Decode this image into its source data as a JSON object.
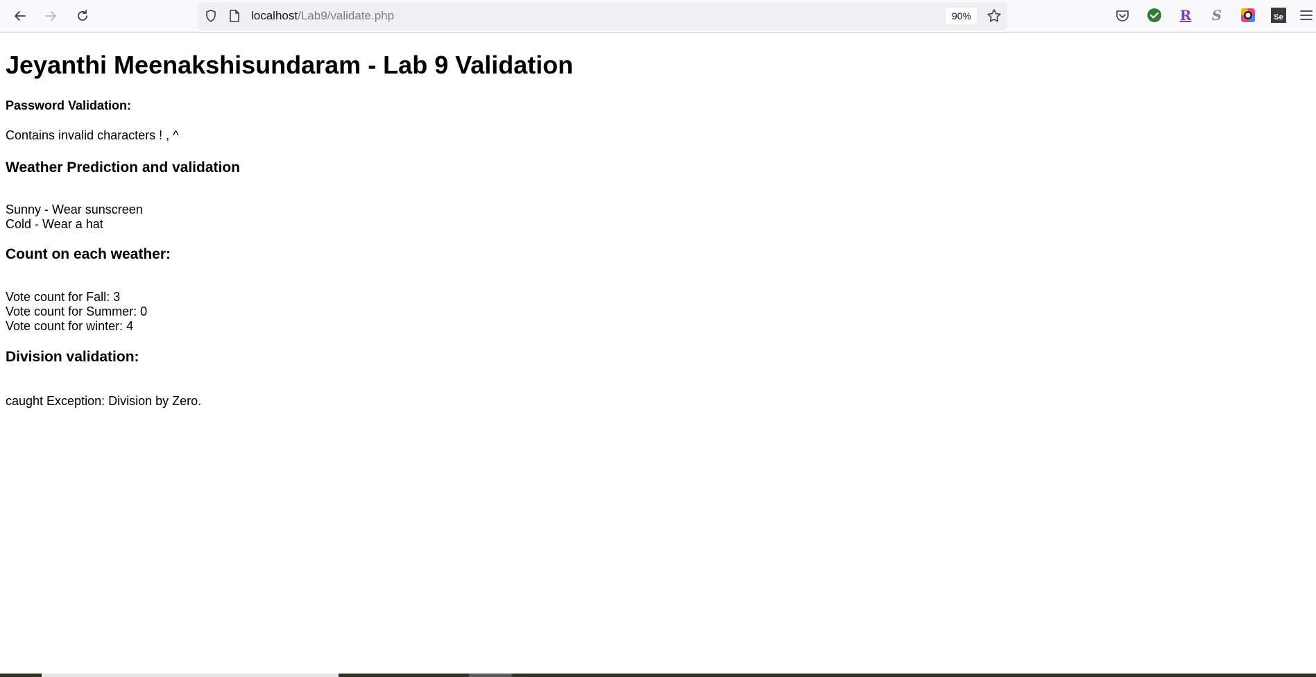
{
  "browser": {
    "url_host": "localhost",
    "url_path": "/Lab9/validate.php",
    "zoom": "90%",
    "icons": [
      "back-icon",
      "forward-icon",
      "reload-icon",
      "shield-icon",
      "page-icon",
      "star-icon",
      "pocket-icon",
      "checkmark-extension-icon",
      "r-extension-icon",
      "s-extension-icon",
      "color-extension-icon",
      "selenium-extension-icon",
      "menu-icon"
    ],
    "extensions": {
      "r_label": "R",
      "s_label": "S",
      "se_label": "Se"
    }
  },
  "page": {
    "title": "Jeyanthi Meenakshisundaram - Lab 9 Validation",
    "password": {
      "heading": "Password Validation:",
      "result": "Contains invalid characters ! , ^"
    },
    "weather": {
      "heading": "Weather Prediction and validation",
      "lines": [
        "Sunny - Wear sunscreen",
        "Cold - Wear a hat"
      ]
    },
    "count": {
      "heading": "Count on each weather:",
      "lines": [
        "Vote count for Fall: 3",
        "Vote count for Summer: 0",
        "Vote count for winter: 4"
      ]
    },
    "division": {
      "heading": "Division validation:",
      "result": "caught Exception: Division by Zero."
    }
  }
}
